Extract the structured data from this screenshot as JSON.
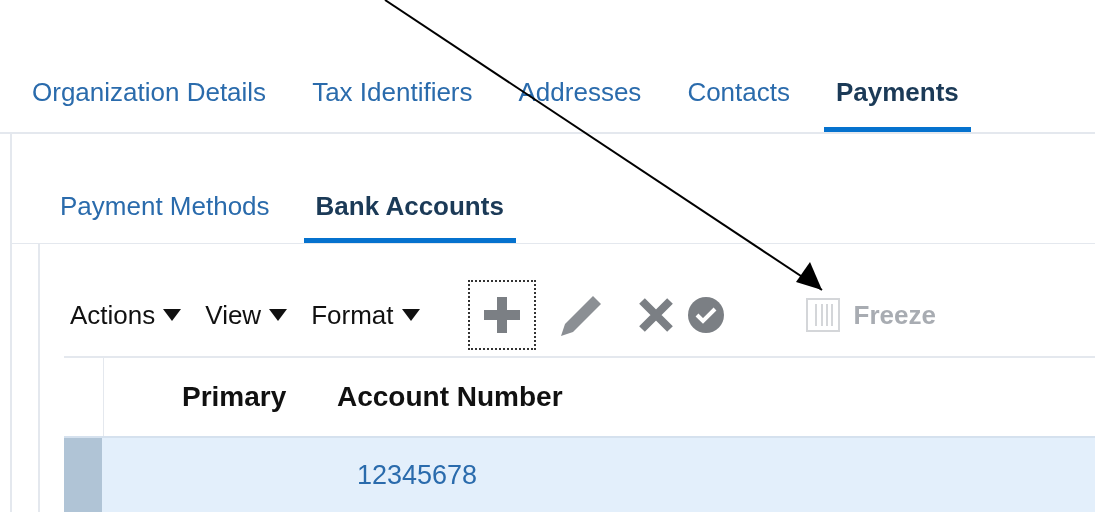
{
  "main_tabs": [
    {
      "label": "Organization Details",
      "selected": false
    },
    {
      "label": "Tax Identifiers",
      "selected": false
    },
    {
      "label": "Addresses",
      "selected": false
    },
    {
      "label": "Contacts",
      "selected": false
    },
    {
      "label": "Payments",
      "selected": true
    }
  ],
  "sub_tabs": [
    {
      "label": "Payment Methods",
      "selected": false
    },
    {
      "label": "Bank Accounts",
      "selected": true
    }
  ],
  "toolbar": {
    "menus": [
      "Actions",
      "View",
      "Format"
    ],
    "freeze": {
      "label": "Freeze",
      "disabled": true
    }
  },
  "table": {
    "columns": [
      "Primary",
      "Account Number"
    ],
    "rows": [
      {
        "account_number": "12345678",
        "selected": true
      }
    ]
  }
}
